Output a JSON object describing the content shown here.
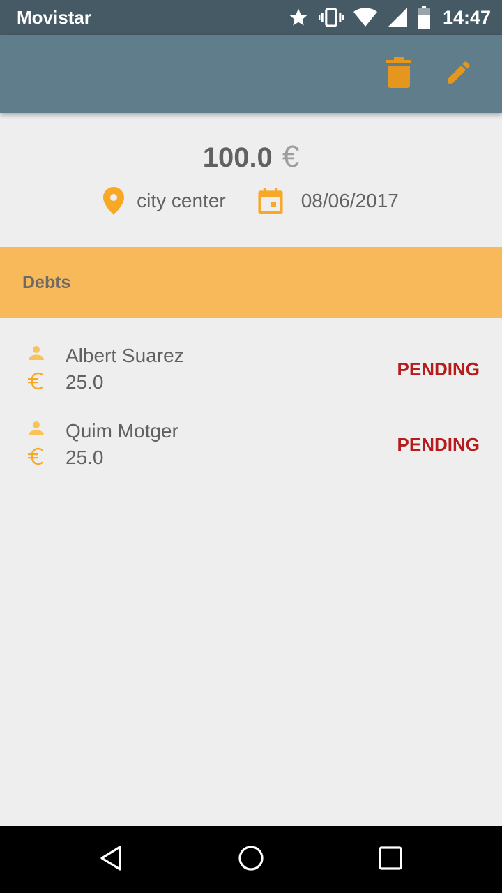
{
  "status_bar": {
    "carrier": "Movistar",
    "time": "14:47",
    "icons": [
      "star-icon",
      "vibrate-icon",
      "wifi-icon",
      "signal-icon",
      "battery-icon"
    ]
  },
  "toolbar": {
    "actions": [
      "delete-icon",
      "edit-icon"
    ],
    "background": "#607d8b",
    "accent": "#e4961e"
  },
  "summary": {
    "amount": "100.0",
    "currency": "€",
    "location": "city center",
    "date": "08/06/2017"
  },
  "debts": {
    "title": "Debts",
    "header_color": "#f8b95a",
    "items": [
      {
        "name": "Albert Suarez",
        "amount": "25.0",
        "status": "PENDING"
      },
      {
        "name": "Quim Motger",
        "amount": "25.0",
        "status": "PENDING"
      }
    ],
    "status_color": "#b71c1c"
  },
  "nav_bar": {
    "buttons": [
      "back-icon",
      "home-icon",
      "recents-icon"
    ]
  }
}
